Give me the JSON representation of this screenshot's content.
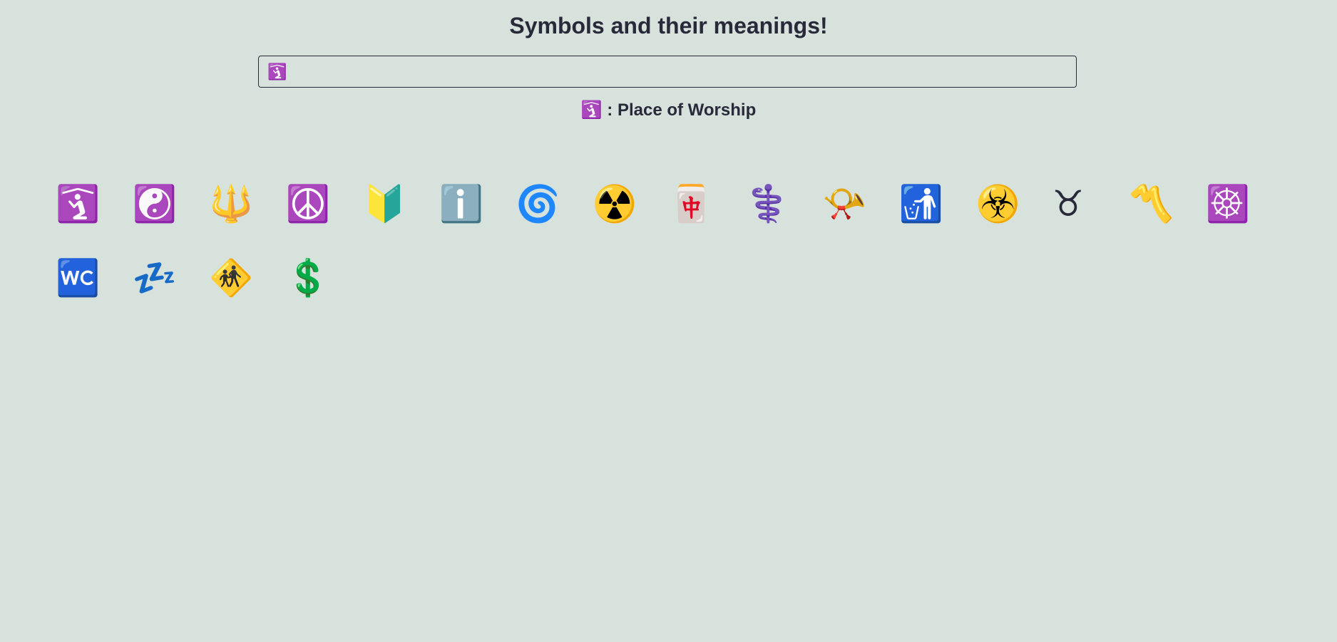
{
  "title": "Symbols and their meanings!",
  "search": {
    "value": "🛐"
  },
  "result": {
    "text": "🛐 : Place of Worship"
  },
  "symbols": [
    "🛐",
    "☯️",
    "🔱",
    "☮️",
    "🔰",
    "ℹ️",
    "🌀",
    "☢️",
    "🀄",
    "⚕️",
    "📯",
    "🚮",
    "☣️",
    "♉",
    "〽️",
    "☸️",
    "🚾",
    "💤",
    "🚸",
    "💲"
  ]
}
